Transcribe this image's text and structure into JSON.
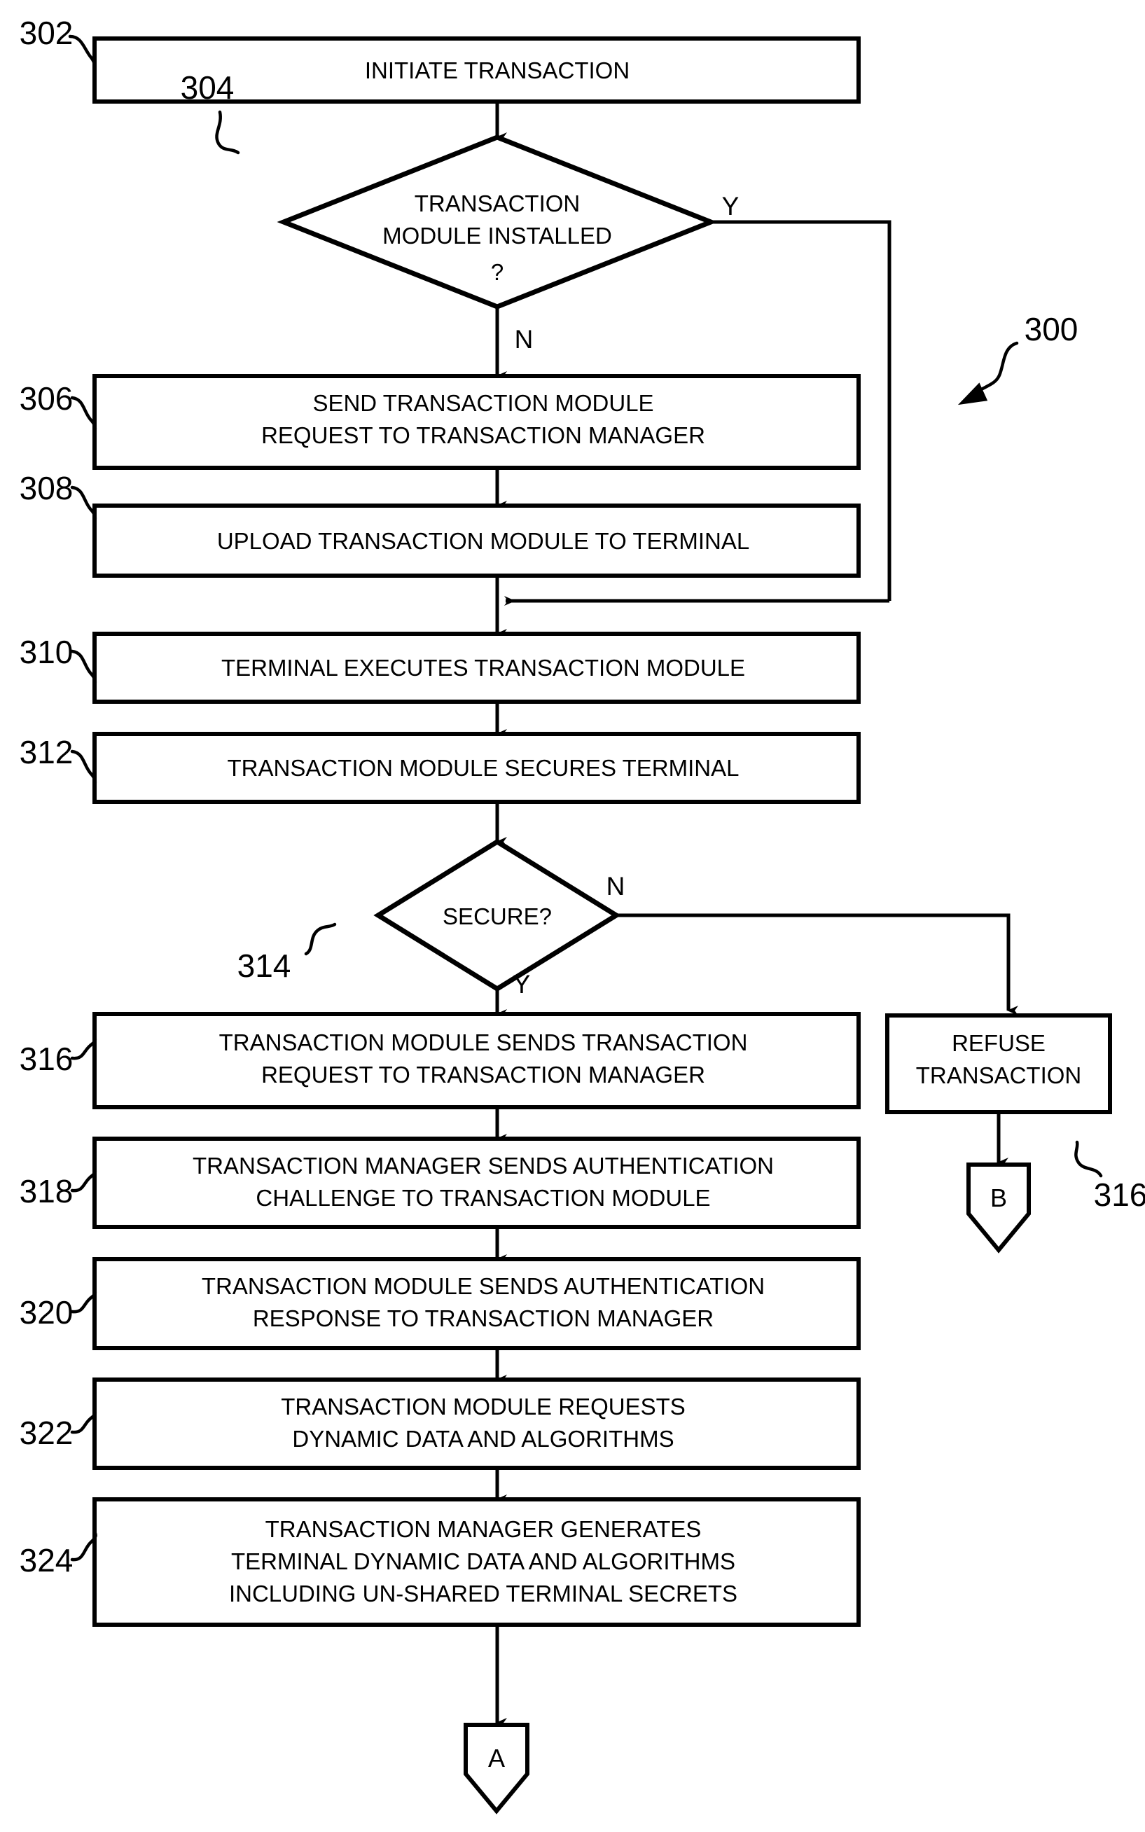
{
  "figure": {
    "figure_label": "300",
    "nodes": [
      {
        "ref": "302",
        "kind": "process",
        "lines": [
          "INITIATE TRANSACTION"
        ]
      },
      {
        "ref": "304",
        "kind": "decision",
        "lines": [
          "TRANSACTION",
          "MODULE INSTALLED",
          "?"
        ]
      },
      {
        "ref": "306",
        "kind": "process",
        "lines": [
          "SEND TRANSACTION MODULE",
          "REQUEST TO TRANSACTION MANAGER"
        ]
      },
      {
        "ref": "308",
        "kind": "process",
        "lines": [
          "UPLOAD TRANSACTION MODULE TO TERMINAL"
        ]
      },
      {
        "ref": "310",
        "kind": "process",
        "lines": [
          "TERMINAL EXECUTES TRANSACTION MODULE"
        ]
      },
      {
        "ref": "312",
        "kind": "process",
        "lines": [
          "TRANSACTION MODULE SECURES TERMINAL"
        ]
      },
      {
        "ref": "314",
        "kind": "decision",
        "lines": [
          "SECURE?"
        ]
      },
      {
        "ref": "316",
        "kind": "process",
        "lines": [
          "TRANSACTION MODULE SENDS TRANSACTION",
          "REQUEST TO TRANSACTION MANAGER"
        ]
      },
      {
        "ref": "318",
        "kind": "process",
        "lines": [
          "TRANSACTION MANAGER SENDS AUTHENTICATION",
          "CHALLENGE TO TRANSACTION MODULE"
        ]
      },
      {
        "ref": "320",
        "kind": "process",
        "lines": [
          "TRANSACTION MODULE SENDS AUTHENTICATION",
          "RESPONSE TO TRANSACTION MANAGER"
        ]
      },
      {
        "ref": "322",
        "kind": "process",
        "lines": [
          "TRANSACTION MODULE REQUESTS",
          "DYNAMIC DATA AND ALGORITHMS"
        ]
      },
      {
        "ref": "324",
        "kind": "process",
        "lines": [
          "TRANSACTION MANAGER GENERATES",
          "TERMINAL DYNAMIC DATA AND ALGORITHMS",
          "INCLUDING UN-SHARED TERMINAL SECRETS"
        ]
      },
      {
        "ref": "316b",
        "kind": "process",
        "lines": [
          "REFUSE",
          "TRANSACTION"
        ]
      }
    ],
    "branch_labels": {
      "d304_yes": "Y",
      "d304_no": "N",
      "d314_no": "N",
      "d314_yes": "Y"
    },
    "connectors": [
      {
        "id": "conn-a",
        "label": "A"
      },
      {
        "id": "conn-b",
        "label": "B"
      }
    ],
    "ref_labels": {
      "r302": "302",
      "r304": "304",
      "r306": "306",
      "r308": "308",
      "r310": "310",
      "r312": "312",
      "r314": "314",
      "r316": "316",
      "r318": "318",
      "r320": "320",
      "r322": "322",
      "r324": "324",
      "r316b": "316",
      "r300": "300"
    },
    "text": {
      "n302_l1": "INITIATE TRANSACTION",
      "n304_l1": "TRANSACTION",
      "n304_l2": "MODULE INSTALLED",
      "n304_l3": "?",
      "n306_l1": "SEND TRANSACTION MODULE",
      "n306_l2": "REQUEST TO TRANSACTION MANAGER",
      "n308_l1": "UPLOAD TRANSACTION MODULE TO TERMINAL",
      "n310_l1": "TERMINAL EXECUTES TRANSACTION MODULE",
      "n312_l1": "TRANSACTION MODULE SECURES TERMINAL",
      "n314_l1": "SECURE?",
      "n316_l1": "TRANSACTION MODULE SENDS TRANSACTION",
      "n316_l2": "REQUEST TO TRANSACTION MANAGER",
      "n318_l1": "TRANSACTION MANAGER SENDS AUTHENTICATION",
      "n318_l2": "CHALLENGE TO TRANSACTION MODULE",
      "n320_l1": "TRANSACTION MODULE SENDS AUTHENTICATION",
      "n320_l2": "RESPONSE TO TRANSACTION MANAGER",
      "n322_l1": "TRANSACTION MODULE REQUESTS",
      "n322_l2": "DYNAMIC DATA AND ALGORITHMS",
      "n324_l1": "TRANSACTION MANAGER GENERATES",
      "n324_l2": "TERMINAL DYNAMIC DATA AND ALGORITHMS",
      "n324_l3": "INCLUDING UN-SHARED TERMINAL SECRETS",
      "n316b_l1": "REFUSE",
      "n316b_l2": "TRANSACTION",
      "conn_a": "A",
      "conn_b": "B"
    },
    "colors": {
      "stroke": "#000000",
      "fill": "#ffffff"
    }
  }
}
